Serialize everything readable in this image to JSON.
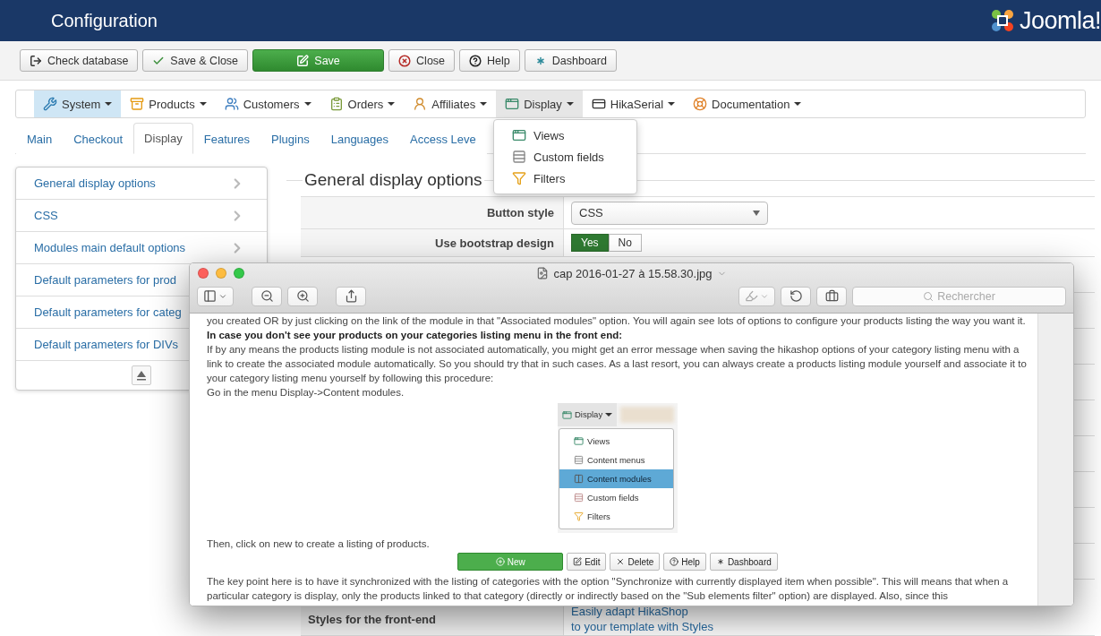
{
  "header": {
    "title": "Configuration",
    "logo_text": "Joomla!"
  },
  "toolbar": [
    {
      "label": "Check database",
      "kind": "default"
    },
    {
      "label": "Save & Close",
      "kind": "default"
    },
    {
      "label": "Save",
      "kind": "primary"
    },
    {
      "label": "Close",
      "kind": "default"
    },
    {
      "label": "Help",
      "kind": "default"
    },
    {
      "label": "Dashboard",
      "kind": "default"
    }
  ],
  "menu": [
    {
      "label": "System",
      "selected": true,
      "open": false
    },
    {
      "label": "Products",
      "selected": false,
      "open": false
    },
    {
      "label": "Customers",
      "selected": false,
      "open": false
    },
    {
      "label": "Orders",
      "selected": false,
      "open": false
    },
    {
      "label": "Affiliates",
      "selected": false,
      "open": false
    },
    {
      "label": "Display",
      "selected": false,
      "open": true
    },
    {
      "label": "HikaSerial",
      "selected": false,
      "open": false
    },
    {
      "label": "Documentation",
      "selected": false,
      "open": false
    }
  ],
  "menu_dropdown": {
    "items": [
      "Views",
      "Custom fields",
      "Filters"
    ]
  },
  "tabs": [
    {
      "label": "Main",
      "selected": false
    },
    {
      "label": "Checkout",
      "selected": false
    },
    {
      "label": "Display",
      "selected": true
    },
    {
      "label": "Features",
      "selected": false
    },
    {
      "label": "Plugins",
      "selected": false
    },
    {
      "label": "Languages",
      "selected": false
    },
    {
      "label": "Access Leve",
      "selected": false
    }
  ],
  "sidebar": {
    "items": [
      "General display options",
      "CSS",
      "Modules main default options",
      "Default parameters for prod",
      "Default parameters for categ",
      "Default parameters for DIVs"
    ]
  },
  "settings": {
    "title": "General display options",
    "rows": [
      {
        "kind": "select",
        "label": "Button style",
        "value": "CSS"
      },
      {
        "kind": "toggle",
        "label": "Use bootstrap design",
        "options": [
          {
            "label": "Yes",
            "selected": true
          },
          {
            "label": "No",
            "selected": false
          }
        ]
      },
      {
        "kind": "link",
        "label": "Styles for the front-end",
        "lines": [
          "Easily adapt HikaShop",
          "to your template with Styles"
        ]
      }
    ]
  },
  "preview": {
    "title": "cap 2016-01-27 à 15.58.30.jpg",
    "search_placeholder": "Rechercher",
    "paragraphs": [
      {
        "kind": "text",
        "text": "you created OR by just clicking on the link of the module in that \"Associated modules\" option. You will again see lots of options to configure your products listing the way you want it."
      },
      {
        "kind": "heading",
        "text": "In case you don't see your products on your categories listing menu in the front end:"
      },
      {
        "kind": "text",
        "text": "If by any means the products listing module is not associated automatically, you might get an error message when saving the hikashop options of your category listing menu with a link to create the associated module automatically. So you should try that in such cases. As a last resort, you can always create a products listing module yourself and associate it to your category listing menu yourself by following this procedure:"
      },
      {
        "kind": "text",
        "text": "Go in the menu Display->Content modules."
      }
    ],
    "embedded_menu": {
      "button": "Display",
      "items": [
        {
          "label": "Views",
          "selected": false
        },
        {
          "label": "Content menus",
          "selected": false
        },
        {
          "label": "Content modules",
          "selected": true
        },
        {
          "label": "Custom fields",
          "selected": false
        },
        {
          "label": "Filters",
          "selected": false
        }
      ]
    },
    "after_text": "Then, click on new to create a listing of products.",
    "buttons": [
      {
        "label": "New",
        "kind": "primary"
      },
      {
        "label": "Edit",
        "kind": "default"
      },
      {
        "label": "Delete",
        "kind": "default"
      },
      {
        "label": "Help",
        "kind": "default"
      },
      {
        "label": "Dashboard",
        "kind": "default"
      }
    ],
    "closing": "The key point here is to have it synchronized with the listing of categories with the option \"Synchronize with currently displayed item when possible\". This will means that when a particular category is display, only the products linked to that category (directly or indirectly based on the \"Sub elements filter\" option) are displayed. Also, since this"
  }
}
